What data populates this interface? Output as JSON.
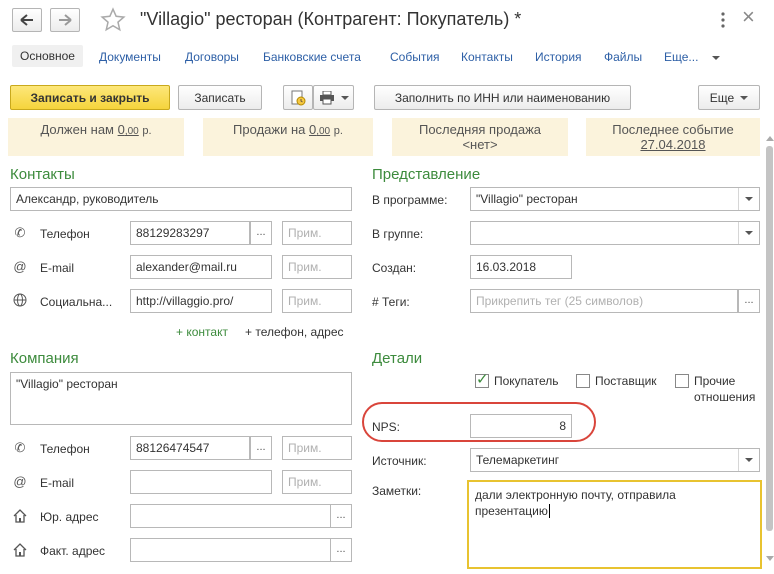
{
  "window": {
    "title": "\"Villagio\" ресторан (Контрагент: Покупатель) *",
    "back_icon": "arrow-left-icon",
    "forward_icon": "arrow-right-icon",
    "favorite_icon": "star-icon",
    "more_icon": "vertical-dots-icon",
    "close_label": "×"
  },
  "tabs": [
    {
      "label": "Основное"
    },
    {
      "label": "Документы"
    },
    {
      "label": "Договоры"
    },
    {
      "label": "Банковские счета"
    },
    {
      "label": "События"
    },
    {
      "label": "Контакты"
    },
    {
      "label": "История"
    },
    {
      "label": "Файлы"
    },
    {
      "label": "Еще..."
    }
  ],
  "toolbar": {
    "save_close": "Записать и закрыть",
    "save": "Записать",
    "fill_inn": "Заполнить по ИНН или наименованию",
    "more": "Еще"
  },
  "info": {
    "owes_label": "Должен нам",
    "owes_int": "0",
    "owes_dec": ",00",
    "owes_cur": "р.",
    "sales_label": "Продажи на",
    "sales_int": "0",
    "sales_dec": ",00",
    "sales_cur": "р.",
    "last_sale_label": "Последняя продажа",
    "last_sale_value": "<нет>",
    "last_event_label": "Последнее событие",
    "last_event_value": "27.04.2018"
  },
  "contacts": {
    "title": "Контакты",
    "person": "Александр, руководитель",
    "phone_label": "Телефон",
    "phone_value": "88129283297",
    "email_label": "E-mail",
    "email_value": "alexander@mail.ru",
    "social_label": "Социальна...",
    "social_value": "http://villaggio.pro/",
    "note_placeholder": "Прим.",
    "add_contact": "+ контакт",
    "add_phone": "+ телефон, адрес"
  },
  "company": {
    "title": "Компания",
    "name": "\"Villagio\" ресторан",
    "phone_label": "Телефон",
    "phone_value": "88126474547",
    "email_label": "E-mail",
    "email_value": "",
    "legal_label": "Юр. адрес",
    "actual_label": "Факт. адрес",
    "note_placeholder": "Прим."
  },
  "presentation": {
    "title": "Представление",
    "in_program_label": "В программе:",
    "in_program_value": "\"Villagio\" ресторан",
    "group_label": "В группе:",
    "group_value": "",
    "created_label": "Создан:",
    "created_value": "16.03.2018",
    "tags_label": "#  Теги:",
    "tags_placeholder": "Прикрепить тег (25 символов)"
  },
  "details": {
    "title": "Детали",
    "buyer_label": "Покупатель",
    "buyer_checked": "✓",
    "supplier_label": "Поставщик",
    "other_label": "Прочие",
    "other_label2": "отношения",
    "nps_label": "NPS:",
    "nps_value": "8",
    "source_label": "Источник:",
    "source_value": "Телемаркетинг",
    "notes_label": "Заметки:",
    "notes_line1": "дали электронную почту, отправила",
    "notes_line2": "презентацию"
  },
  "colors": {
    "accent_green": "#3d8b3d",
    "link_blue": "#2d5fa6",
    "primary_yellow": "#f5d43c",
    "highlight_red": "#d9453b",
    "notes_border": "#e8c330"
  }
}
